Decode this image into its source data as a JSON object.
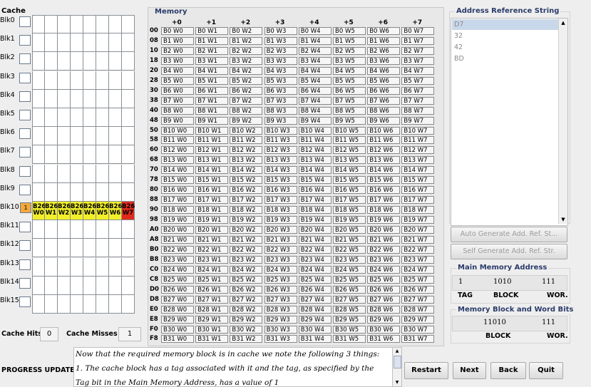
{
  "cache": {
    "title": "Cache",
    "blocks": [
      "Blk0",
      "Blk1",
      "Blk2",
      "Blk3",
      "Blk4",
      "Blk5",
      "Blk6",
      "Blk7",
      "Blk8",
      "Blk9",
      "Blk10",
      "Blk11",
      "Blk12",
      "Blk13",
      "Blk14",
      "Blk15"
    ],
    "active_block": {
      "index": 10,
      "tag": "1",
      "words": [
        "B26 W0",
        "B26 W1",
        "B26 W2",
        "B26 W3",
        "B26 W4",
        "B26 W5",
        "B26 W6",
        "B26 W7"
      ]
    },
    "hits_label": "Cache Hits",
    "hits_value": "0",
    "misses_label": "Cache Misses",
    "misses_value": "1"
  },
  "memory": {
    "title": "Memory",
    "columns": [
      "+0",
      "+1",
      "+2",
      "+3",
      "+4",
      "+5",
      "+6",
      "+7"
    ],
    "rows": [
      "00",
      "08",
      "10",
      "18",
      "20",
      "28",
      "30",
      "38",
      "40",
      "48",
      "50",
      "58",
      "60",
      "68",
      "70",
      "78",
      "80",
      "88",
      "90",
      "98",
      "A0",
      "A8",
      "B0",
      "B8",
      "C0",
      "C8",
      "D0",
      "D8",
      "E0",
      "E8",
      "F0",
      "F8"
    ],
    "cells": [
      [
        "B0 W0",
        "B0 W1",
        "B0 W2",
        "B0 W3",
        "B0 W4",
        "B0 W5",
        "B0 W6",
        "B0 W7"
      ],
      [
        "B1 W0",
        "B1 W1",
        "B1 W2",
        "B1 W3",
        "B1 W4",
        "B1 W5",
        "B1 W6",
        "B1 W7"
      ],
      [
        "B2 W0",
        "B2 W1",
        "B2 W2",
        "B2 W3",
        "B2 W4",
        "B2 W5",
        "B2 W6",
        "B2 W7"
      ],
      [
        "B3 W0",
        "B3 W1",
        "B3 W2",
        "B3 W3",
        "B3 W4",
        "B3 W5",
        "B3 W6",
        "B3 W7"
      ],
      [
        "B4 W0",
        "B4 W1",
        "B4 W2",
        "B4 W3",
        "B4 W4",
        "B4 W5",
        "B4 W6",
        "B4 W7"
      ],
      [
        "B5 W0",
        "B5 W1",
        "B5 W2",
        "B5 W3",
        "B5 W4",
        "B5 W5",
        "B5 W6",
        "B5 W7"
      ],
      [
        "B6 W0",
        "B6 W1",
        "B6 W2",
        "B6 W3",
        "B6 W4",
        "B6 W5",
        "B6 W6",
        "B6 W7"
      ],
      [
        "B7 W0",
        "B7 W1",
        "B7 W2",
        "B7 W3",
        "B7 W4",
        "B7 W5",
        "B7 W6",
        "B7 W7"
      ],
      [
        "B8 W0",
        "B8 W1",
        "B8 W2",
        "B8 W3",
        "B8 W4",
        "B8 W5",
        "B8 W6",
        "B8 W7"
      ],
      [
        "B9 W0",
        "B9 W1",
        "B9 W2",
        "B9 W3",
        "B9 W4",
        "B9 W5",
        "B9 W6",
        "B9 W7"
      ],
      [
        "B10 W0",
        "B10 W1",
        "B10 W2",
        "B10 W3",
        "B10 W4",
        "B10 W5",
        "B10 W6",
        "B10 W7"
      ],
      [
        "B11 W0",
        "B11 W1",
        "B11 W2",
        "B11 W3",
        "B11 W4",
        "B11 W5",
        "B11 W6",
        "B11 W7"
      ],
      [
        "B12 W0",
        "B12 W1",
        "B12 W2",
        "B12 W3",
        "B12 W4",
        "B12 W5",
        "B12 W6",
        "B12 W7"
      ],
      [
        "B13 W0",
        "B13 W1",
        "B13 W2",
        "B13 W3",
        "B13 W4",
        "B13 W5",
        "B13 W6",
        "B13 W7"
      ],
      [
        "B14 W0",
        "B14 W1",
        "B14 W2",
        "B14 W3",
        "B14 W4",
        "B14 W5",
        "B14 W6",
        "B14 W7"
      ],
      [
        "B15 W0",
        "B15 W1",
        "B15 W2",
        "B15 W3",
        "B15 W4",
        "B15 W5",
        "B15 W6",
        "B15 W7"
      ],
      [
        "B16 W0",
        "B16 W1",
        "B16 W2",
        "B16 W3",
        "B16 W4",
        "B16 W5",
        "B16 W6",
        "B16 W7"
      ],
      [
        "B17 W0",
        "B17 W1",
        "B17 W2",
        "B17 W3",
        "B17 W4",
        "B17 W5",
        "B17 W6",
        "B17 W7"
      ],
      [
        "B18 W0",
        "B18 W1",
        "B18 W2",
        "B18 W3",
        "B18 W4",
        "B18 W5",
        "B18 W6",
        "B18 W7"
      ],
      [
        "B19 W0",
        "B19 W1",
        "B19 W2",
        "B19 W3",
        "B19 W4",
        "B19 W5",
        "B19 W6",
        "B19 W7"
      ],
      [
        "B20 W0",
        "B20 W1",
        "B20 W2",
        "B20 W3",
        "B20 W4",
        "B20 W5",
        "B20 W6",
        "B20 W7"
      ],
      [
        "B21 W0",
        "B21 W1",
        "B21 W2",
        "B21 W3",
        "B21 W4",
        "B21 W5",
        "B21 W6",
        "B21 W7"
      ],
      [
        "B22 W0",
        "B22 W1",
        "B22 W2",
        "B22 W3",
        "B22 W4",
        "B22 W5",
        "B22 W6",
        "B22 W7"
      ],
      [
        "B23 W0",
        "B23 W1",
        "B23 W2",
        "B23 W3",
        "B23 W4",
        "B23 W5",
        "B23 W6",
        "B23 W7"
      ],
      [
        "B24 W0",
        "B24 W1",
        "B24 W2",
        "B24 W3",
        "B24 W4",
        "B24 W5",
        "B24 W6",
        "B24 W7"
      ],
      [
        "B25 W0",
        "B25 W1",
        "B25 W2",
        "B25 W3",
        "B25 W4",
        "B25 W5",
        "B25 W6",
        "B25 W7"
      ],
      [
        "B26 W0",
        "B26 W1",
        "B26 W2",
        "B26 W3",
        "B26 W4",
        "B26 W5",
        "B26 W6",
        "B26 W7"
      ],
      [
        "B27 W0",
        "B27 W1",
        "B27 W2",
        "B27 W3",
        "B27 W4",
        "B27 W5",
        "B27 W6",
        "B27 W7"
      ],
      [
        "B28 W0",
        "B28 W1",
        "B28 W2",
        "B28 W3",
        "B28 W4",
        "B28 W5",
        "B28 W6",
        "B28 W7"
      ],
      [
        "B29 W0",
        "B29 W1",
        "B29 W2",
        "B29 W3",
        "B29 W4",
        "B29 W5",
        "B29 W6",
        "B29 W7"
      ],
      [
        "B30 W0",
        "B30 W1",
        "B30 W2",
        "B30 W3",
        "B30 W4",
        "B30 W5",
        "B30 W6",
        "B30 W7"
      ],
      [
        "B31 W0",
        "B31 W1",
        "B31 W2",
        "B31 W3",
        "B31 W4",
        "B31 W5",
        "B31 W6",
        "B31 W7"
      ]
    ]
  },
  "address_ref": {
    "title": "Address Reference String",
    "items": [
      "D7",
      "32",
      "42",
      "BD"
    ],
    "selected_index": 0,
    "auto_button": "Auto Generate Add. Ref. St...",
    "self_button": "Self Generate Add. Ref. Str."
  },
  "main_memory_address": {
    "title": "Main Memory Address",
    "tag_value": "1",
    "block_value": "1010",
    "word_value": "111",
    "tag_label": "TAG",
    "block_label": "BLOCK",
    "word_label": "WOR."
  },
  "mem_block_word": {
    "title": "Memory Block and Word Bits",
    "block_value": "11010",
    "word_value": "111",
    "block_label": "BLOCK",
    "word_label": "WOR."
  },
  "progress": {
    "label": "PROGRESS UPDATE",
    "lines": [
      "Now that the required memory block is in cache we note the following 3 things:",
      "1. The cache block has a tag associated with it and the tag, as specified by the",
      "Tag bit in the Main Memory Address, has a value of 1"
    ]
  },
  "buttons": {
    "restart": "Restart",
    "next": "Next",
    "back": "Back",
    "quit": "Quit"
  },
  "colors": {
    "highlight_yellow": "#f2ef2a",
    "highlight_red": "#e02a1e",
    "tag_orange": "#f2a93a",
    "title_blue": "#2a3b6a",
    "list_selected": "#c9d7ea"
  }
}
